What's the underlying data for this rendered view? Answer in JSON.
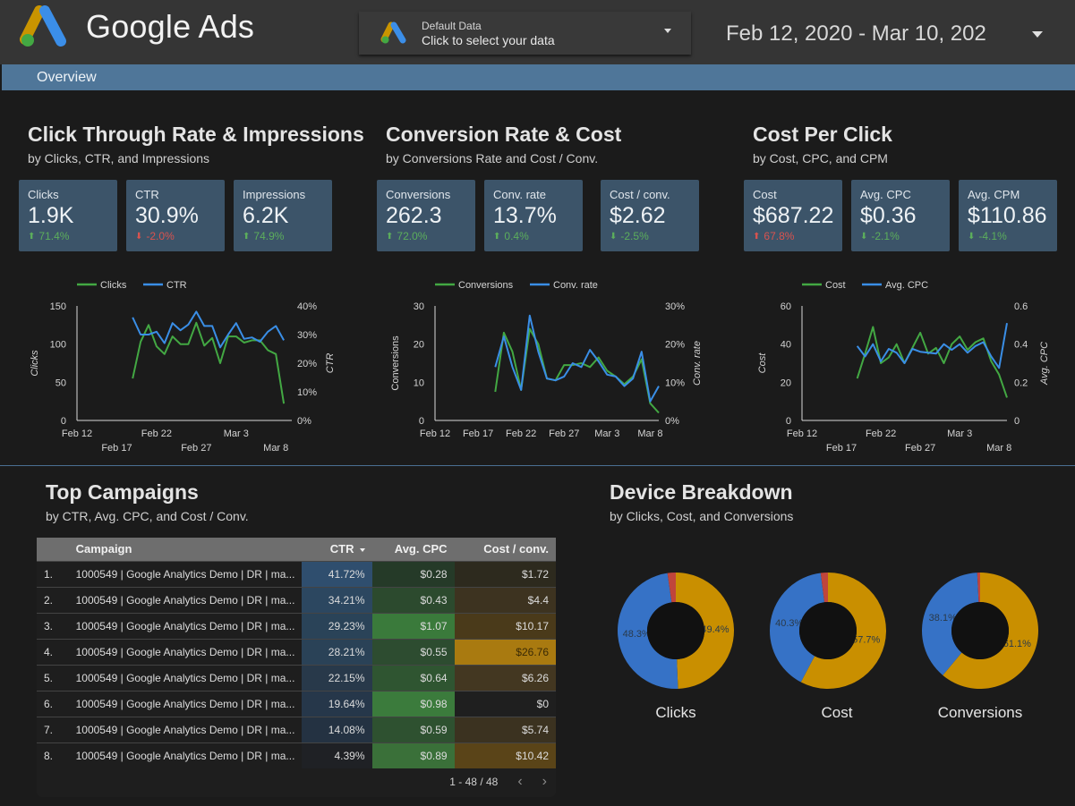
{
  "header": {
    "brand": "Google Ads",
    "data_source": {
      "label": "Default Data",
      "value": "Click to select your data"
    },
    "date_range": "Feb 12, 2020 - Mar 10, 202"
  },
  "nav": {
    "items": [
      {
        "label": "Overview"
      }
    ]
  },
  "colors": {
    "accent_blue": "#4f7699",
    "kpi_bg": "#3c5469",
    "series_green": "#43a843",
    "series_blue": "#3a8ee6",
    "positive": "#5cae5c",
    "negative": "#d9534f",
    "donut_blue": "#3672c6",
    "donut_gold": "#c98f00",
    "donut_red": "#c0453c"
  },
  "sections": {
    "ctr": {
      "title": "Click Through Rate & Impressions",
      "subtitle": "by Clicks, CTR, and Impressions",
      "kpis": [
        {
          "label": "Clicks",
          "value": "1.9K",
          "delta": "71.4%",
          "direction": "up",
          "sentiment": "good"
        },
        {
          "label": "CTR",
          "value": "30.9%",
          "delta": "-2.0%",
          "direction": "down",
          "sentiment": "bad"
        },
        {
          "label": "Impressions",
          "value": "6.2K",
          "delta": "74.9%",
          "direction": "up",
          "sentiment": "good"
        }
      ]
    },
    "conv": {
      "title": "Conversion Rate & Cost",
      "subtitle": "by Conversions Rate and Cost / Conv.",
      "kpis": [
        {
          "label": "Conversions",
          "value": "262.3",
          "delta": "72.0%",
          "direction": "up",
          "sentiment": "good"
        },
        {
          "label": "Conv. rate",
          "value": "13.7%",
          "delta": "0.4%",
          "direction": "up",
          "sentiment": "good"
        },
        {
          "label": "Cost / conv.",
          "value": "$2.62",
          "delta": "-2.5%",
          "direction": "down",
          "sentiment": "good"
        }
      ]
    },
    "cpc": {
      "title": "Cost Per Click",
      "subtitle": "by Cost, CPC, and CPM",
      "kpis": [
        {
          "label": "Cost",
          "value": "$687.22",
          "delta": "67.8%",
          "direction": "up",
          "sentiment": "bad"
        },
        {
          "label": "Avg. CPC",
          "value": "$0.36",
          "delta": "-2.1%",
          "direction": "down",
          "sentiment": "good"
        },
        {
          "label": "Avg. CPM",
          "value": "$110.86",
          "delta": "-4.1%",
          "direction": "down",
          "sentiment": "good"
        }
      ]
    },
    "campaigns": {
      "title": "Top Campaigns",
      "subtitle": "by CTR, Avg. CPC, and Cost / Conv.",
      "columns": [
        "",
        "Campaign",
        "CTR",
        "Avg. CPC",
        "Cost / conv."
      ],
      "sorted_column": "CTR",
      "rows": [
        {
          "idx": "1.",
          "campaign": "1000549 | Google Analytics Demo | DR | ma...",
          "ctr": "41.72%",
          "cpc": "$0.28",
          "cpv": "$1.72"
        },
        {
          "idx": "2.",
          "campaign": "1000549 | Google Analytics Demo | DR | ma...",
          "ctr": "34.21%",
          "cpc": "$0.43",
          "cpv": "$4.4"
        },
        {
          "idx": "3.",
          "campaign": "1000549 | Google Analytics Demo | DR | ma...",
          "ctr": "29.23%",
          "cpc": "$1.07",
          "cpv": "$10.17"
        },
        {
          "idx": "4.",
          "campaign": "1000549 | Google Analytics Demo | DR | ma...",
          "ctr": "28.21%",
          "cpc": "$0.55",
          "cpv": "$26.76"
        },
        {
          "idx": "5.",
          "campaign": "1000549 | Google Analytics Demo | DR | ma...",
          "ctr": "22.15%",
          "cpc": "$0.64",
          "cpv": "$6.26"
        },
        {
          "idx": "6.",
          "campaign": "1000549 | Google Analytics Demo | DR | ma...",
          "ctr": "19.64%",
          "cpc": "$0.98",
          "cpv": "$0"
        },
        {
          "idx": "7.",
          "campaign": "1000549 | Google Analytics Demo | DR | ma...",
          "ctr": "14.08%",
          "cpc": "$0.59",
          "cpv": "$5.74"
        },
        {
          "idx": "8.",
          "campaign": "1000549 | Google Analytics Demo | DR | ma...",
          "ctr": "4.39%",
          "cpc": "$0.89",
          "cpv": "$10.42"
        }
      ],
      "pagination": "1 - 48 / 48"
    },
    "device": {
      "title": "Device Breakdown",
      "subtitle": "by Clicks, Cost, and Conversions"
    }
  },
  "chart_data": [
    {
      "type": "line",
      "id": "clicks-ctr",
      "legend": [
        "Clicks",
        "CTR"
      ],
      "legend_placement": "top",
      "ylabel": "Clicks",
      "y2label": "CTR",
      "ylim": [
        0,
        150
      ],
      "yticks": [
        "0",
        "50",
        "100",
        "150"
      ],
      "y2lim": [
        0,
        0.4
      ],
      "y2ticks": [
        "0%",
        "10%",
        "20%",
        "30%",
        "40%"
      ],
      "xlim_days": [
        0,
        27
      ],
      "xticks": [
        {
          "label": "Feb 12",
          "day": 0,
          "row": 0
        },
        {
          "label": "Feb 17",
          "day": 5,
          "row": 1
        },
        {
          "label": "Feb 22",
          "day": 10,
          "row": 0
        },
        {
          "label": "Feb 27",
          "day": 15,
          "row": 1
        },
        {
          "label": "Mar 3",
          "day": 20,
          "row": 0
        },
        {
          "label": "Mar 8",
          "day": 25,
          "row": 1
        }
      ],
      "start_day": 7,
      "series": [
        {
          "name": "Clicks",
          "axis": "left",
          "values": [
            55,
            103,
            125,
            97,
            87,
            110,
            100,
            100,
            128,
            98,
            108,
            75,
            110,
            110,
            102,
            105,
            105,
            92,
            87,
            22
          ]
        },
        {
          "name": "CTR",
          "axis": "right",
          "values": [
            0.36,
            0.3,
            0.3,
            0.31,
            0.27,
            0.34,
            0.315,
            0.335,
            0.38,
            0.33,
            0.33,
            0.255,
            0.3,
            0.34,
            0.285,
            0.29,
            0.275,
            0.31,
            0.33,
            0.28
          ]
        }
      ]
    },
    {
      "type": "line",
      "id": "conv-rate",
      "legend": [
        "Conversions",
        "Conv. rate"
      ],
      "legend_placement": "top",
      "ylabel": "Conversions",
      "y2label": "Conv. rate",
      "ylim": [
        0,
        30
      ],
      "yticks": [
        "0",
        "10",
        "20",
        "30"
      ],
      "y2lim": [
        0,
        0.3
      ],
      "y2ticks": [
        "0%",
        "10%",
        "20%",
        "30%"
      ],
      "xlim_days": [
        0,
        26
      ],
      "xticks": [
        {
          "label": "Feb 12",
          "day": 0,
          "row": 0
        },
        {
          "label": "Feb 17",
          "day": 5,
          "row": 0
        },
        {
          "label": "Feb 22",
          "day": 10,
          "row": 0
        },
        {
          "label": "Feb 27",
          "day": 15,
          "row": 0
        },
        {
          "label": "Mar 3",
          "day": 20,
          "row": 0
        },
        {
          "label": "Mar 8",
          "day": 25,
          "row": 0
        }
      ],
      "start_day": 7,
      "series": [
        {
          "name": "Conversions",
          "axis": "left",
          "values": [
            7.5,
            23,
            18,
            8,
            24,
            20,
            11,
            10.5,
            14.5,
            14.5,
            15,
            14,
            16.5,
            13,
            11.5,
            9.5,
            11.5,
            16,
            4.5,
            2
          ]
        },
        {
          "name": "Conv. rate",
          "axis": "right",
          "values": [
            0.14,
            0.22,
            0.14,
            0.08,
            0.275,
            0.18,
            0.11,
            0.105,
            0.115,
            0.15,
            0.14,
            0.185,
            0.155,
            0.12,
            0.115,
            0.09,
            0.11,
            0.18,
            0.05,
            0.09
          ]
        }
      ]
    },
    {
      "type": "line",
      "id": "cost-cpc",
      "legend": [
        "Cost",
        "Avg. CPC"
      ],
      "legend_placement": "top",
      "ylabel": "Cost",
      "y2label": "Avg. CPC",
      "ylim": [
        0,
        60
      ],
      "yticks": [
        "0",
        "20",
        "40",
        "60"
      ],
      "y2lim": [
        0,
        0.6
      ],
      "y2ticks": [
        "0",
        "0.2",
        "0.4",
        "0.6"
      ],
      "xlim_days": [
        0,
        26
      ],
      "xticks": [
        {
          "label": "Feb 12",
          "day": 0,
          "row": 0
        },
        {
          "label": "Feb 17",
          "day": 5,
          "row": 1
        },
        {
          "label": "Feb 22",
          "day": 10,
          "row": 0
        },
        {
          "label": "Feb 27",
          "day": 15,
          "row": 1
        },
        {
          "label": "Mar 3",
          "day": 20,
          "row": 0
        },
        {
          "label": "Mar 8",
          "day": 25,
          "row": 1
        }
      ],
      "start_day": 7,
      "series": [
        {
          "name": "Cost",
          "axis": "left",
          "values": [
            22,
            35,
            49,
            30,
            33,
            40,
            30,
            38,
            46,
            35,
            38,
            30,
            40,
            44,
            37,
            41,
            43,
            31,
            24,
            12
          ]
        },
        {
          "name": "Avg. CPC",
          "axis": "right",
          "values": [
            0.39,
            0.335,
            0.4,
            0.31,
            0.375,
            0.355,
            0.3,
            0.375,
            0.36,
            0.355,
            0.35,
            0.4,
            0.37,
            0.4,
            0.355,
            0.39,
            0.41,
            0.335,
            0.275,
            0.51
          ]
        }
      ]
    },
    {
      "type": "pie",
      "id": "device-clicks",
      "title": "Clicks",
      "slices": [
        {
          "name": "gold",
          "value": 49.4,
          "label": "49.4%"
        },
        {
          "name": "blue",
          "value": 48.3,
          "label": "48.3%"
        },
        {
          "name": "red",
          "value": 2.3,
          "label": ""
        }
      ]
    },
    {
      "type": "pie",
      "id": "device-cost",
      "title": "Cost",
      "slices": [
        {
          "name": "gold",
          "value": 57.7,
          "label": "57.7%"
        },
        {
          "name": "blue",
          "value": 40.3,
          "label": "40.3%"
        },
        {
          "name": "red",
          "value": 2.0,
          "label": ""
        }
      ]
    },
    {
      "type": "pie",
      "id": "device-conversions",
      "title": "Conversions",
      "slices": [
        {
          "name": "gold",
          "value": 61.1,
          "label": "61.1%"
        },
        {
          "name": "blue",
          "value": 38.1,
          "label": "38.1%"
        },
        {
          "name": "red",
          "value": 0.8,
          "label": ""
        }
      ]
    }
  ]
}
